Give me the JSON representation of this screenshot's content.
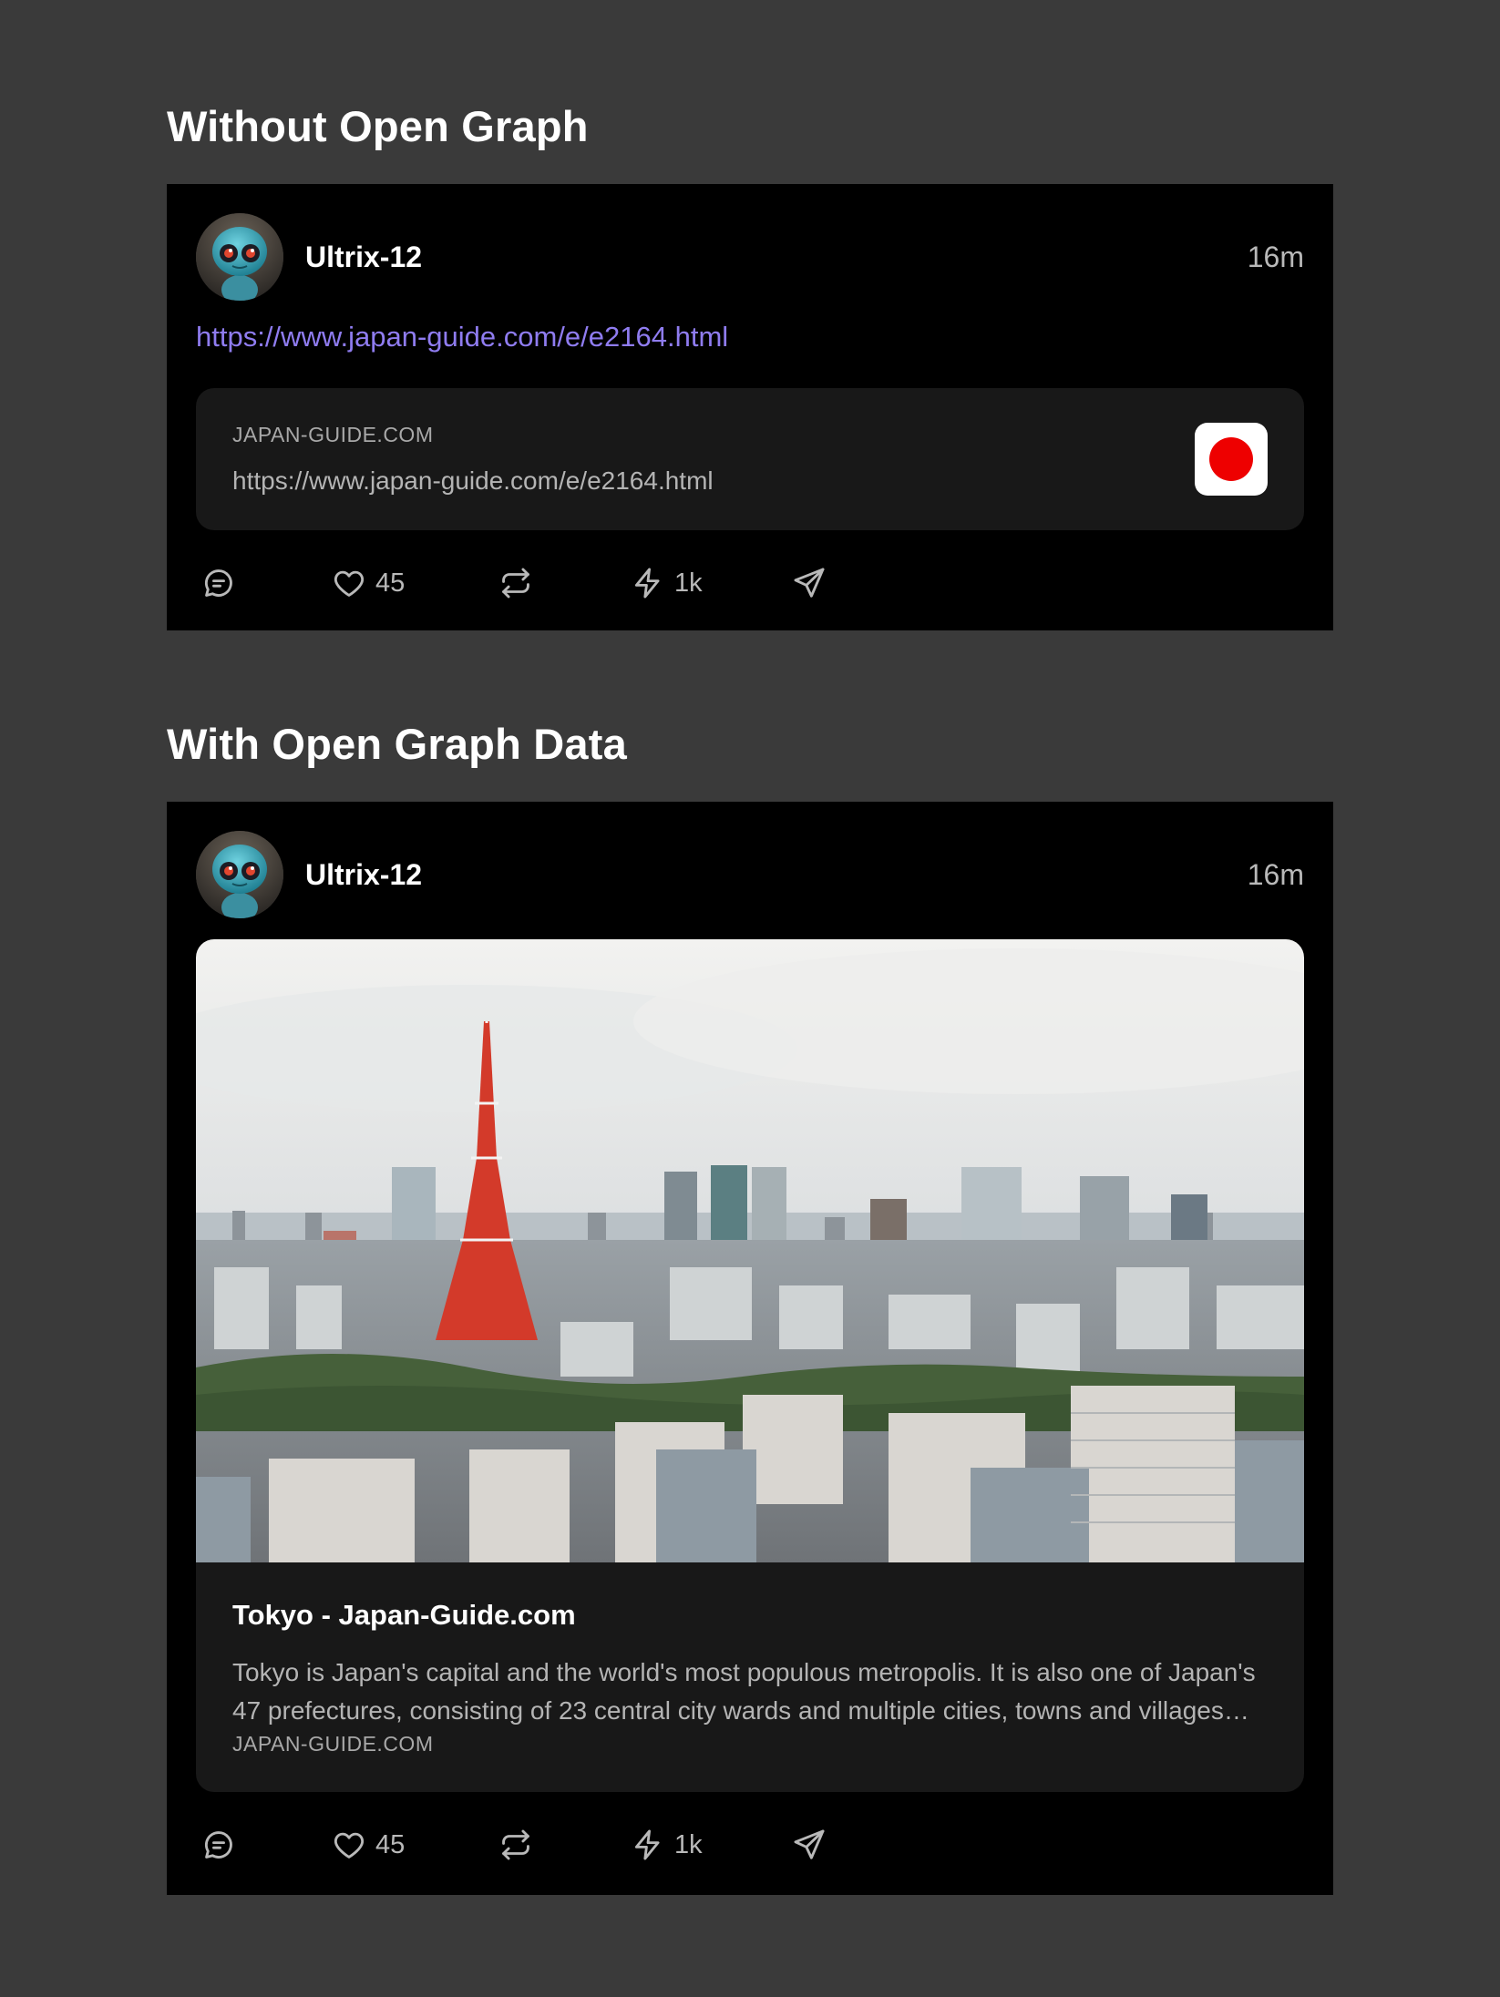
{
  "sections": [
    {
      "title": "Without Open Graph",
      "post": {
        "username": "Ultrix-12",
        "timestamp": "16m",
        "link": "https://www.japan-guide.com/e/e2164.html",
        "preview": {
          "domain": "JAPAN-GUIDE.COM",
          "url": "https://www.japan-guide.com/e/e2164.html",
          "favicon_color": "#ee0000"
        },
        "actions": {
          "likes": "45",
          "zaps": "1k"
        }
      }
    },
    {
      "title": "With Open Graph Data",
      "post": {
        "username": "Ultrix-12",
        "timestamp": "16m",
        "og": {
          "title": "Tokyo - Japan-Guide.com",
          "description": "Tokyo  is Japan's capital and the world's most populous metropolis. It is also one of Japan's 47 prefectures, consisting of 23 central city wards and multiple cities, towns and villages west of the city center.",
          "domain": "JAPAN-GUIDE.COM"
        },
        "actions": {
          "likes": "45",
          "zaps": "1k"
        }
      }
    }
  ],
  "colors": {
    "page_background": "#3a3a3a",
    "card_background": "#000000",
    "preview_background": "#181818",
    "link": "#8f7cf0",
    "muted_text": "#b9b9b9"
  },
  "icons": [
    "avatar-robot",
    "comment-icon",
    "heart-icon",
    "repost-icon",
    "zap-icon",
    "send-icon"
  ]
}
